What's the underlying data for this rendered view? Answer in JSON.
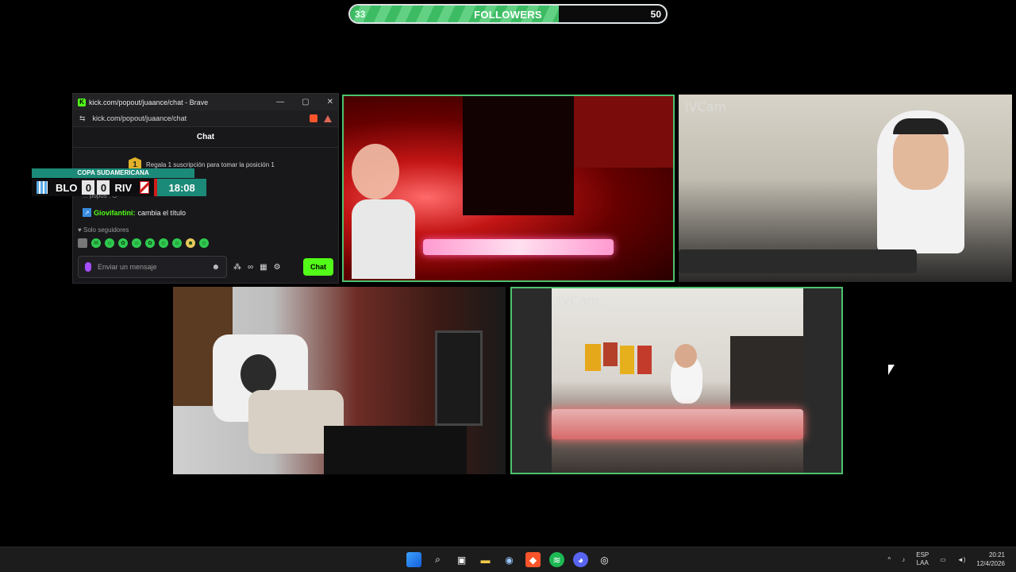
{
  "followers_bar": {
    "current": "33",
    "title": "FOLLOWERS",
    "goal": "50",
    "progress": 0.66
  },
  "cams": {
    "cam2_label": "iVCam",
    "cam4_label": "iVCam"
  },
  "chat_window": {
    "title": "kick.com/popout/juaance/chat - Brave",
    "url": "kick.com/popout/juaance/chat",
    "header": "Chat",
    "gift_position": "1",
    "gift_text": "Regala 1 suscripción para tomar la posición 1",
    "prev_message": "... popus : O",
    "message_user": "Giovifantini:",
    "message_text": "cambia el título",
    "followers_only": "Solo seguidores",
    "input_placeholder": "Enviar un mensaje",
    "send_label": "Chat",
    "infinity": "∞"
  },
  "scoreboard": {
    "competition": "COPA SUDAMERICANA",
    "home": "BLO",
    "home_goals": "0",
    "away_goals": "0",
    "away": "RIV",
    "time": "18:08"
  },
  "taskbar": {
    "lang_top": "ESP",
    "lang_bottom": "LAA",
    "time": "20:21",
    "date": "12/4/2026"
  },
  "colors": {
    "kick_green": "#53fc18",
    "cam_border": "#4cc36e"
  }
}
